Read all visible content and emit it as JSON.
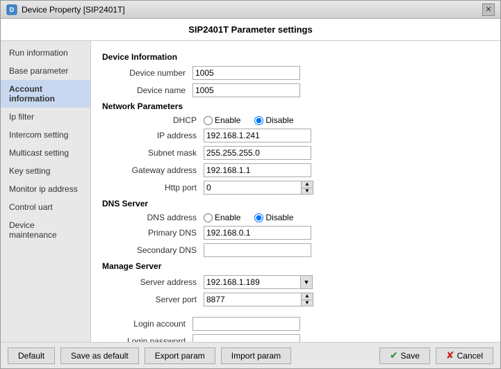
{
  "window": {
    "title": "Device Property [SIP2401T]",
    "header": "SIP2401T Parameter settings"
  },
  "sidebar": {
    "items": [
      {
        "id": "run-information",
        "label": "Run information",
        "active": false
      },
      {
        "id": "base-parameter",
        "label": "Base parameter",
        "active": false
      },
      {
        "id": "account-information",
        "label": "Account information",
        "active": true
      },
      {
        "id": "ip-filter",
        "label": "Ip filter",
        "active": false
      },
      {
        "id": "intercom-setting",
        "label": "Intercom setting",
        "active": false
      },
      {
        "id": "multicast-setting",
        "label": "Multicast setting",
        "active": false
      },
      {
        "id": "key-setting",
        "label": "Key setting",
        "active": false
      },
      {
        "id": "monitor-ip-address",
        "label": "Monitor ip address",
        "active": false
      },
      {
        "id": "control-uart",
        "label": "Control uart",
        "active": false
      },
      {
        "id": "device-maintenance",
        "label": "Device maintenance",
        "active": false
      }
    ]
  },
  "main": {
    "device_information_header": "Device Information",
    "device_number_label": "Device number",
    "device_number_value": "1005",
    "device_name_label": "Device name",
    "device_name_value": "1005",
    "network_parameters_header": "Network Parameters",
    "dhcp_label": "DHCP",
    "dhcp_enable_label": "Enable",
    "dhcp_disable_label": "Disable",
    "ip_address_label": "IP address",
    "ip_address_value": "192.168.1.241",
    "subnet_mask_label": "Subnet mask",
    "subnet_mask_value": "255.255.255.0",
    "gateway_label": "Gateway address",
    "gateway_value": "192.168.1.1",
    "http_port_label": "Http port",
    "http_port_value": "0",
    "dns_server_header": "DNS Server",
    "dns_address_label": "DNS address",
    "dns_enable_label": "Enable",
    "dns_disable_label": "Disable",
    "primary_dns_label": "Primary DNS",
    "primary_dns_value": "192.168.0.1",
    "secondary_dns_label": "Secondary DNS",
    "secondary_dns_value": "",
    "manage_server_header": "Manage Server",
    "server_address_label": "Server address",
    "server_address_value": "192.168.1.189",
    "server_port_label": "Server port",
    "server_port_value": "8877",
    "login_account_label": "Login account",
    "login_account_value": "",
    "login_password_label": "Login password",
    "login_password_value": ""
  },
  "footer": {
    "default_label": "Default",
    "save_as_default_label": "Save as default",
    "export_param_label": "Export param",
    "import_param_label": "Import param",
    "save_label": "Save",
    "cancel_label": "Cancel"
  }
}
